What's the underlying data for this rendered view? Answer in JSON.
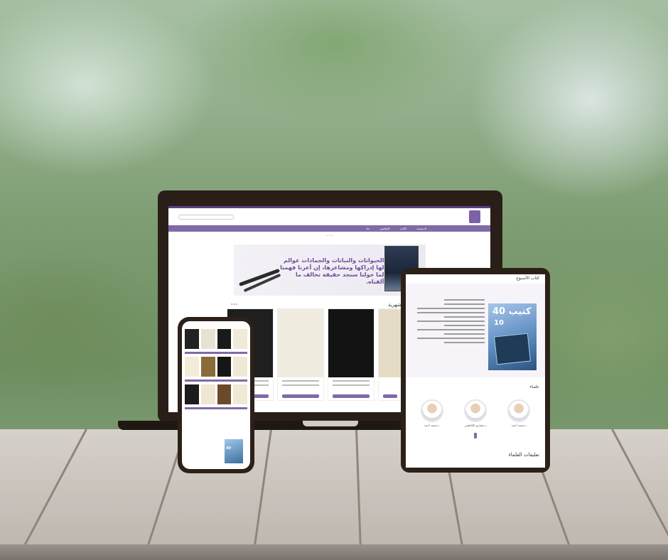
{
  "scene": "device mockup",
  "colors": {
    "brand": "#7f6aa6",
    "brand_dark": "#5b3f86",
    "device_frame": "#2c2119",
    "table": "#c9c2bb"
  },
  "laptop": {
    "banner_quote": "الحيوانات والنباتات والجمادات عوالم لها إدراكها ومشاعرها، إن أعرنا فهمنا لما حولنا سنجد حقيقة تخالف ما ألفناه.",
    "section_title": "شهرية",
    "nav_items": [
      "الرئيسية",
      "الكتب",
      "المؤلفين",
      "عنا"
    ],
    "book_covers": [
      "#1b1b1b",
      "#f2efe6",
      "#121212",
      "#e6dfc9"
    ]
  },
  "phone": {
    "promo_number": "40"
  },
  "tablet": {
    "header": "كتاب الأسبوع",
    "promo_big": "40 كتيب",
    "promo_small": "10",
    "section_scholars": "علماء",
    "section_bottom": "تعليقات العلماء",
    "scholars": [
      {
        "name": "د.محمد أحمد"
      },
      {
        "name": "د.مشاري الكاظمي"
      },
      {
        "name": "د.محمد أحمد"
      }
    ]
  }
}
